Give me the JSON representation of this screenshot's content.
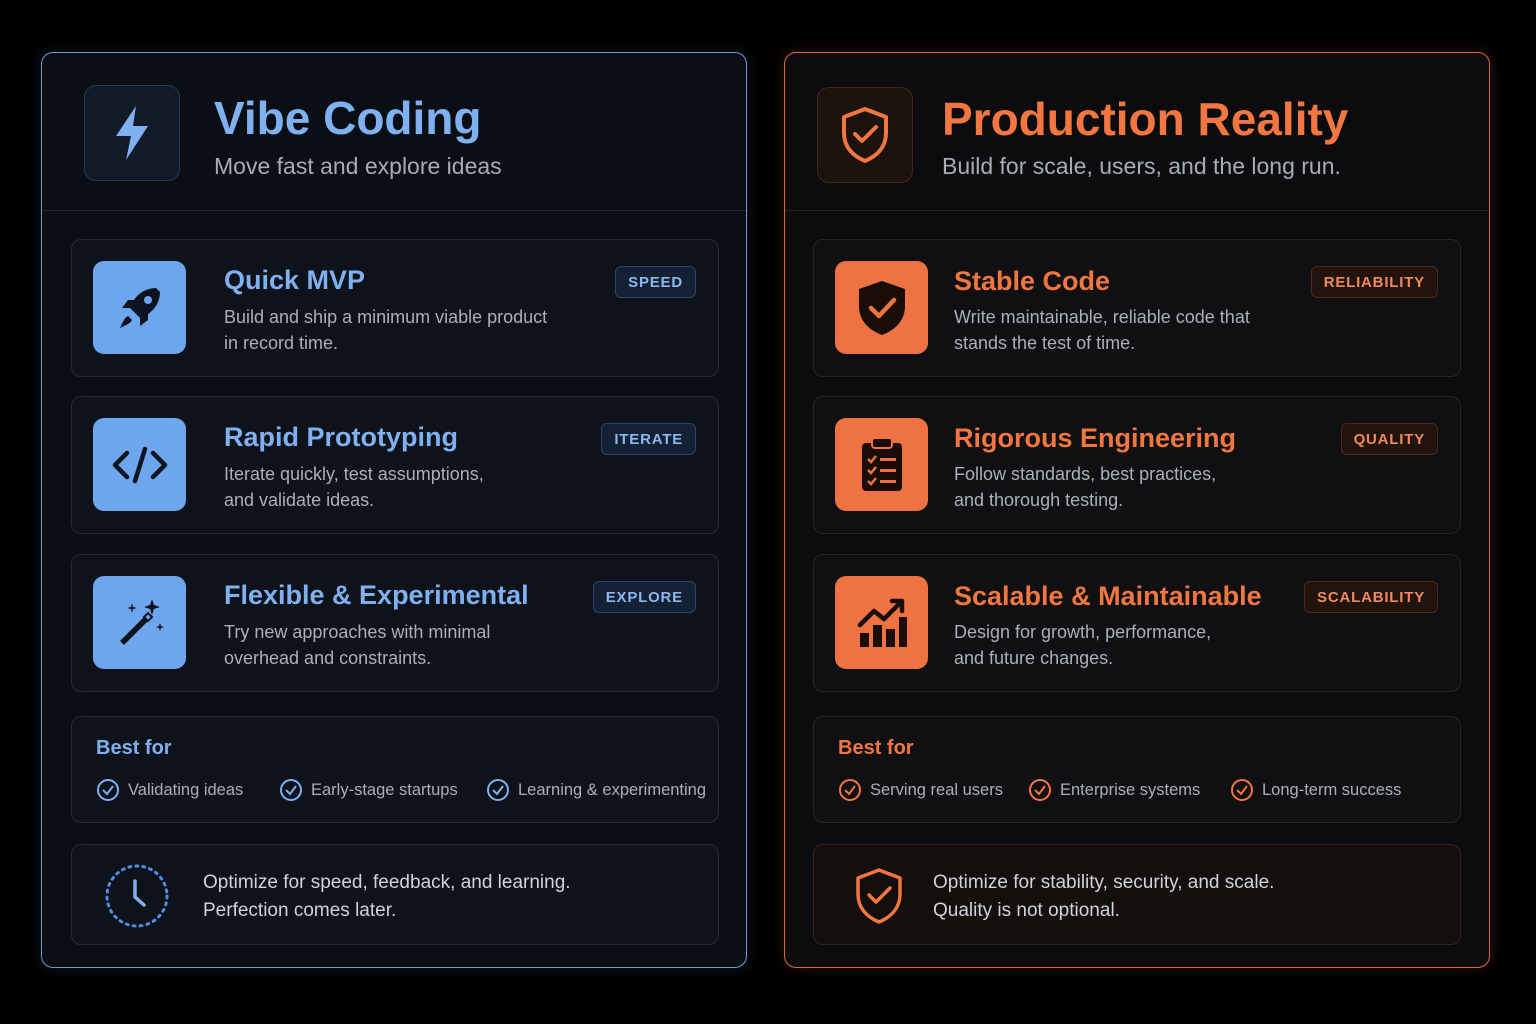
{
  "left": {
    "title": "Vibe Coding",
    "subtitle": "Move fast and explore ideas",
    "header_icon": "lightning-icon",
    "cards": [
      {
        "title": "Quick MVP",
        "desc1": "Build and ship a minimum viable product",
        "desc2": "in record time.",
        "badge": "SPEED",
        "icon": "rocket-icon"
      },
      {
        "title": "Rapid Prototyping",
        "desc1": "Iterate quickly, test assumptions,",
        "desc2": "and validate ideas.",
        "badge": "ITERATE",
        "icon": "code-icon"
      },
      {
        "title": "Flexible & Experimental",
        "desc1": "Try new approaches with minimal",
        "desc2": "overhead and constraints.",
        "badge": "EXPLORE",
        "icon": "magic-wand-icon"
      }
    ],
    "best_for": {
      "title": "Best for",
      "items": [
        "Validating ideas",
        "Early-stage startups",
        "Learning & experimenting"
      ]
    },
    "footer": {
      "line1": "Optimize for speed, feedback, and learning.",
      "line2": "Perfection comes later.",
      "icon": "clock-icon"
    }
  },
  "right": {
    "title": "Production Reality",
    "subtitle": "Build for scale, users, and the long run.",
    "header_icon": "shield-check-icon",
    "cards": [
      {
        "title": "Stable Code",
        "desc1": "Write maintainable, reliable code that",
        "desc2": "stands the test of time.",
        "badge": "RELIABILITY",
        "icon": "shield-check-icon"
      },
      {
        "title": "Rigorous Engineering",
        "desc1": "Follow standards, best practices,",
        "desc2": "and thorough testing.",
        "badge": "QUALITY",
        "icon": "clipboard-checklist-icon"
      },
      {
        "title": "Scalable & Maintainable",
        "desc1": "Design for growth, performance,",
        "desc2": "and future changes.",
        "badge": "SCALABILITY",
        "icon": "growth-chart-icon"
      }
    ],
    "best_for": {
      "title": "Best for",
      "items": [
        "Serving real users",
        "Enterprise systems",
        "Long-term success"
      ]
    },
    "footer": {
      "line1": "Optimize for stability, security, and scale.",
      "line2": "Quality is not optional.",
      "icon": "shield-check-icon"
    }
  },
  "colors": {
    "blue_accent": "#7fb0f0",
    "orange_accent": "#f2763f",
    "background": "#000000"
  }
}
